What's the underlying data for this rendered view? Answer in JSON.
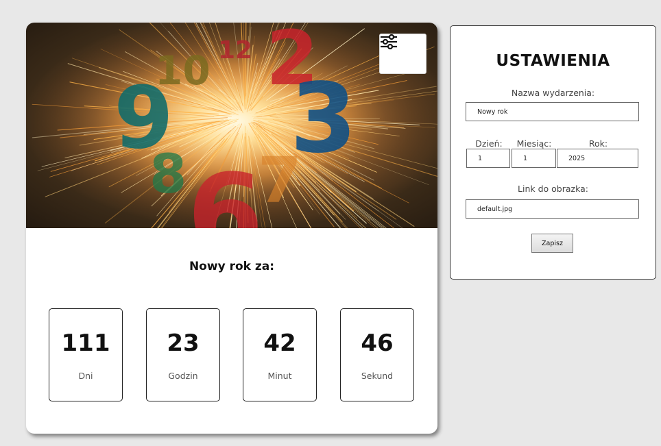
{
  "card": {
    "event_heading": "Nowy rok za:",
    "hero_numerals": [
      "10",
      "12",
      "2",
      "9",
      "3",
      "8",
      "6",
      "7"
    ],
    "countdown": [
      {
        "value": "111",
        "unit": "Dni"
      },
      {
        "value": "23",
        "unit": "Godzin"
      },
      {
        "value": "42",
        "unit": "Minut"
      },
      {
        "value": "46",
        "unit": "Sekund"
      }
    ]
  },
  "settings": {
    "title": "USTAWIENIA",
    "event_name_label": "Nazwa wydarzenia:",
    "event_name_value": "Nowy rok",
    "day_label": "Dzień:",
    "day_value": "1",
    "month_label": "Miesiąc:",
    "month_value": "1",
    "year_label": "Rok:",
    "year_value": "2025",
    "image_link_label": "Link do obrazka:",
    "image_link_value": "default.jpg",
    "save_label": "Zapisz"
  },
  "icons": {
    "settings_button": "sliders-icon"
  },
  "colors": {
    "page_background": "#e8e8e8",
    "digit_teal": "#0e6b6b",
    "digit_blue": "#0b4f86",
    "digit_red": "#c8232c",
    "digit_olive": "#7a6a20",
    "digit_green": "#1f7a4a",
    "digit_orange": "#d9822b"
  }
}
